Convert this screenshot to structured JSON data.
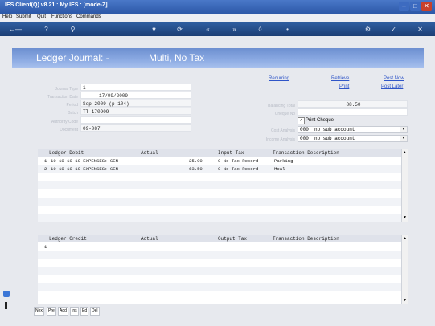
{
  "window": {
    "title": "IES Client(Q) v8.21 : My IES :     [mode-Z]"
  },
  "menu": [
    "Help",
    "Submit",
    "Quit",
    "Functions",
    "Commands"
  ],
  "header": {
    "title_left": "Ledger Journal: -",
    "title_right": "Multi, No Tax"
  },
  "form": {
    "journal_type_label": "Journal Type",
    "journal_type_value": "1",
    "transaction_date_label": "Transaction Date",
    "transaction_date_value": "17/09/2009",
    "period_label": "Period",
    "period_value": "Sep 2009 (p 104)",
    "batch_label": "Batch",
    "batch_value": "TT-170909",
    "authority_code_label": "Authority Code",
    "authority_code_value": "",
    "document_label": "Document",
    "document_value": "09-087",
    "balancing_total_label": "Balancing Total",
    "balancing_total_value": "88.50",
    "cheque_no_label": "Cheque No",
    "cheque_no_value": "",
    "print_cheque_label": "Print Cheque",
    "cost_analysis_label": "Cost Analysis",
    "cost_analysis_value": "000: no sub account",
    "income_analysis_label": "Income Analysis",
    "income_analysis_value": "000: no sub account"
  },
  "links": {
    "recurring": "Recurring",
    "retrieve": "Retrieve",
    "print": "Print",
    "post_now": "Post Now",
    "post_later": "Post Later"
  },
  "debit_grid": {
    "headers": [
      "Ledger Debit",
      "Actual",
      "Input Tax",
      "Transaction Description"
    ],
    "rows": [
      {
        "num": "1",
        "ledger": "10-10-10-10 EXPENSES: GEN",
        "actual": "25.00",
        "tax": "0 No Tax Record",
        "desc": "Parking"
      },
      {
        "num": "2",
        "ledger": "10-10-10-10 EXPENSES: GEN",
        "actual": "63.50",
        "tax": "0 No Tax Record",
        "desc": "Meal"
      }
    ]
  },
  "credit_grid": {
    "headers": [
      "Ledger Credit",
      "Actual",
      "Output Tax",
      "Transaction Description"
    ],
    "rows": [
      {
        "num": "1"
      }
    ]
  },
  "bottom_buttons": [
    "Nex",
    "Pre",
    "Add",
    "Ins",
    "Ed",
    "Del"
  ]
}
